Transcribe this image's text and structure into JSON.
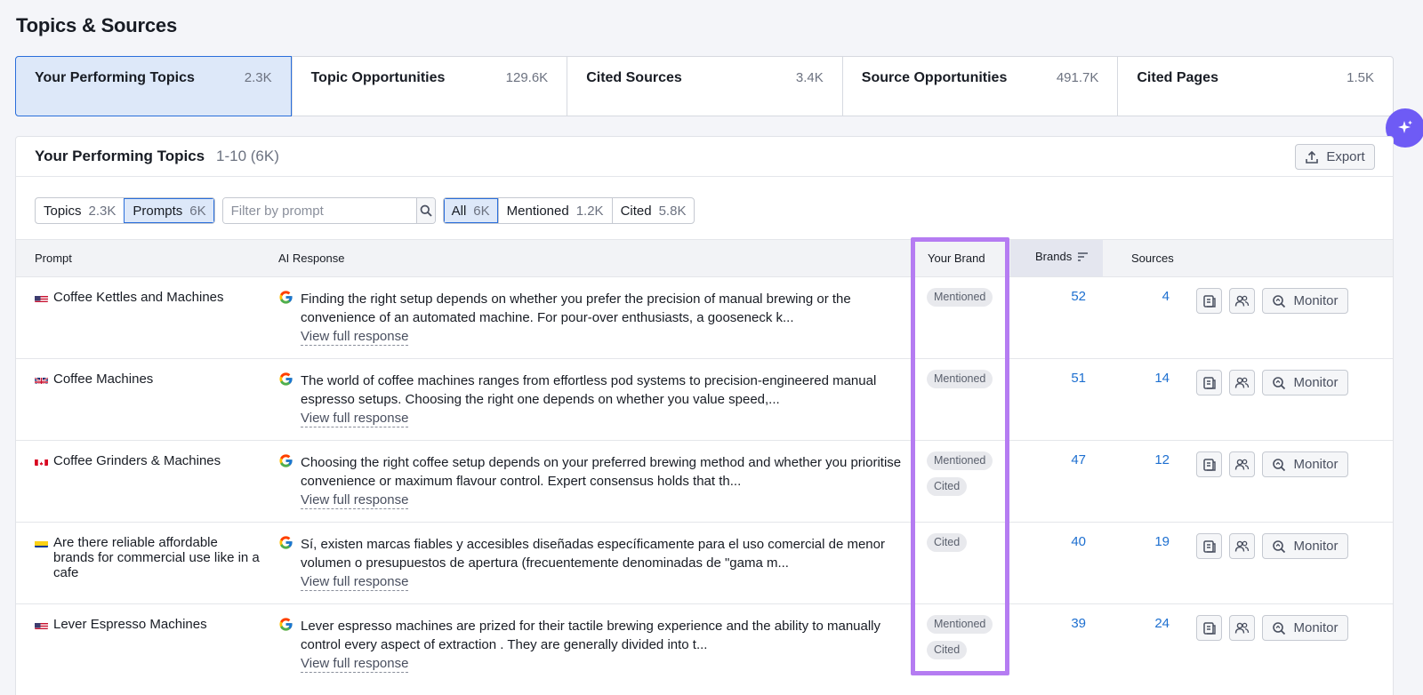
{
  "page_title": "Topics & Sources",
  "tabs": [
    {
      "label": "Your Performing Topics",
      "count": "2.3K"
    },
    {
      "label": "Topic Opportunities",
      "count": "129.6K"
    },
    {
      "label": "Cited Sources",
      "count": "3.4K"
    },
    {
      "label": "Source Opportunities",
      "count": "491.7K"
    },
    {
      "label": "Cited Pages",
      "count": "1.5K"
    }
  ],
  "card": {
    "title": "Your Performing Topics",
    "range": "1-10 (6K)",
    "export_label": "Export"
  },
  "view_toggle": [
    {
      "label": "Topics",
      "count": "2.3K"
    },
    {
      "label": "Prompts",
      "count": "6K"
    }
  ],
  "search": {
    "placeholder": "Filter by prompt"
  },
  "status_filter": [
    {
      "label": "All",
      "count": "6K"
    },
    {
      "label": "Mentioned",
      "count": "1.2K"
    },
    {
      "label": "Cited",
      "count": "5.8K"
    }
  ],
  "columns": {
    "prompt": "Prompt",
    "ai_response": "AI Response",
    "your_brand": "Your Brand",
    "brands": "Brands",
    "sources": "Sources"
  },
  "view_full_label": "View full response",
  "monitor_label": "Monitor",
  "rows": [
    {
      "flag": "us",
      "prompt": "Coffee Kettles and Machines",
      "response": "Finding the right setup depends on whether you prefer the precision of manual brewing or the convenience of an automated machine. For pour-over enthusiasts, a gooseneck k...",
      "badges": [
        "Mentioned"
      ],
      "brands": "52",
      "sources": "4"
    },
    {
      "flag": "uk",
      "prompt": "Coffee Machines",
      "response": "The world of coffee machines ranges from effortless pod systems to precision-engineered manual espresso setups. Choosing the right one depends on whether you value speed,...",
      "badges": [
        "Mentioned"
      ],
      "brands": "51",
      "sources": "14"
    },
    {
      "flag": "ca",
      "prompt": "Coffee Grinders & Machines",
      "response": "Choosing the right coffee setup depends on your preferred brewing method and whether you prioritise convenience or maximum flavour control. Expert consensus holds that th...",
      "badges": [
        "Mentioned",
        "Cited"
      ],
      "brands": "47",
      "sources": "12"
    },
    {
      "flag": "co",
      "prompt": "Are there reliable affordable brands for commercial use like in a cafe",
      "response": "Sí, existen marcas fiables y accesibles diseñadas específicamente para el uso comercial de menor volumen o presupuestos de apertura (frecuentemente denominadas de \"gama m...",
      "badges": [
        "Cited"
      ],
      "brands": "40",
      "sources": "19"
    },
    {
      "flag": "us",
      "prompt": "Lever Espresso Machines",
      "response": "Lever espresso machines are prized for their tactile brewing experience and the ability to manually control every aspect of extraction . They are generally divided into t...",
      "badges": [
        "Mentioned",
        "Cited"
      ],
      "brands": "39",
      "sources": "24"
    }
  ],
  "colors": {
    "accent": "#2a6edb",
    "link_number": "#1d6fd0",
    "highlight": "#b57cf2",
    "fab": "#6e5bf5"
  }
}
